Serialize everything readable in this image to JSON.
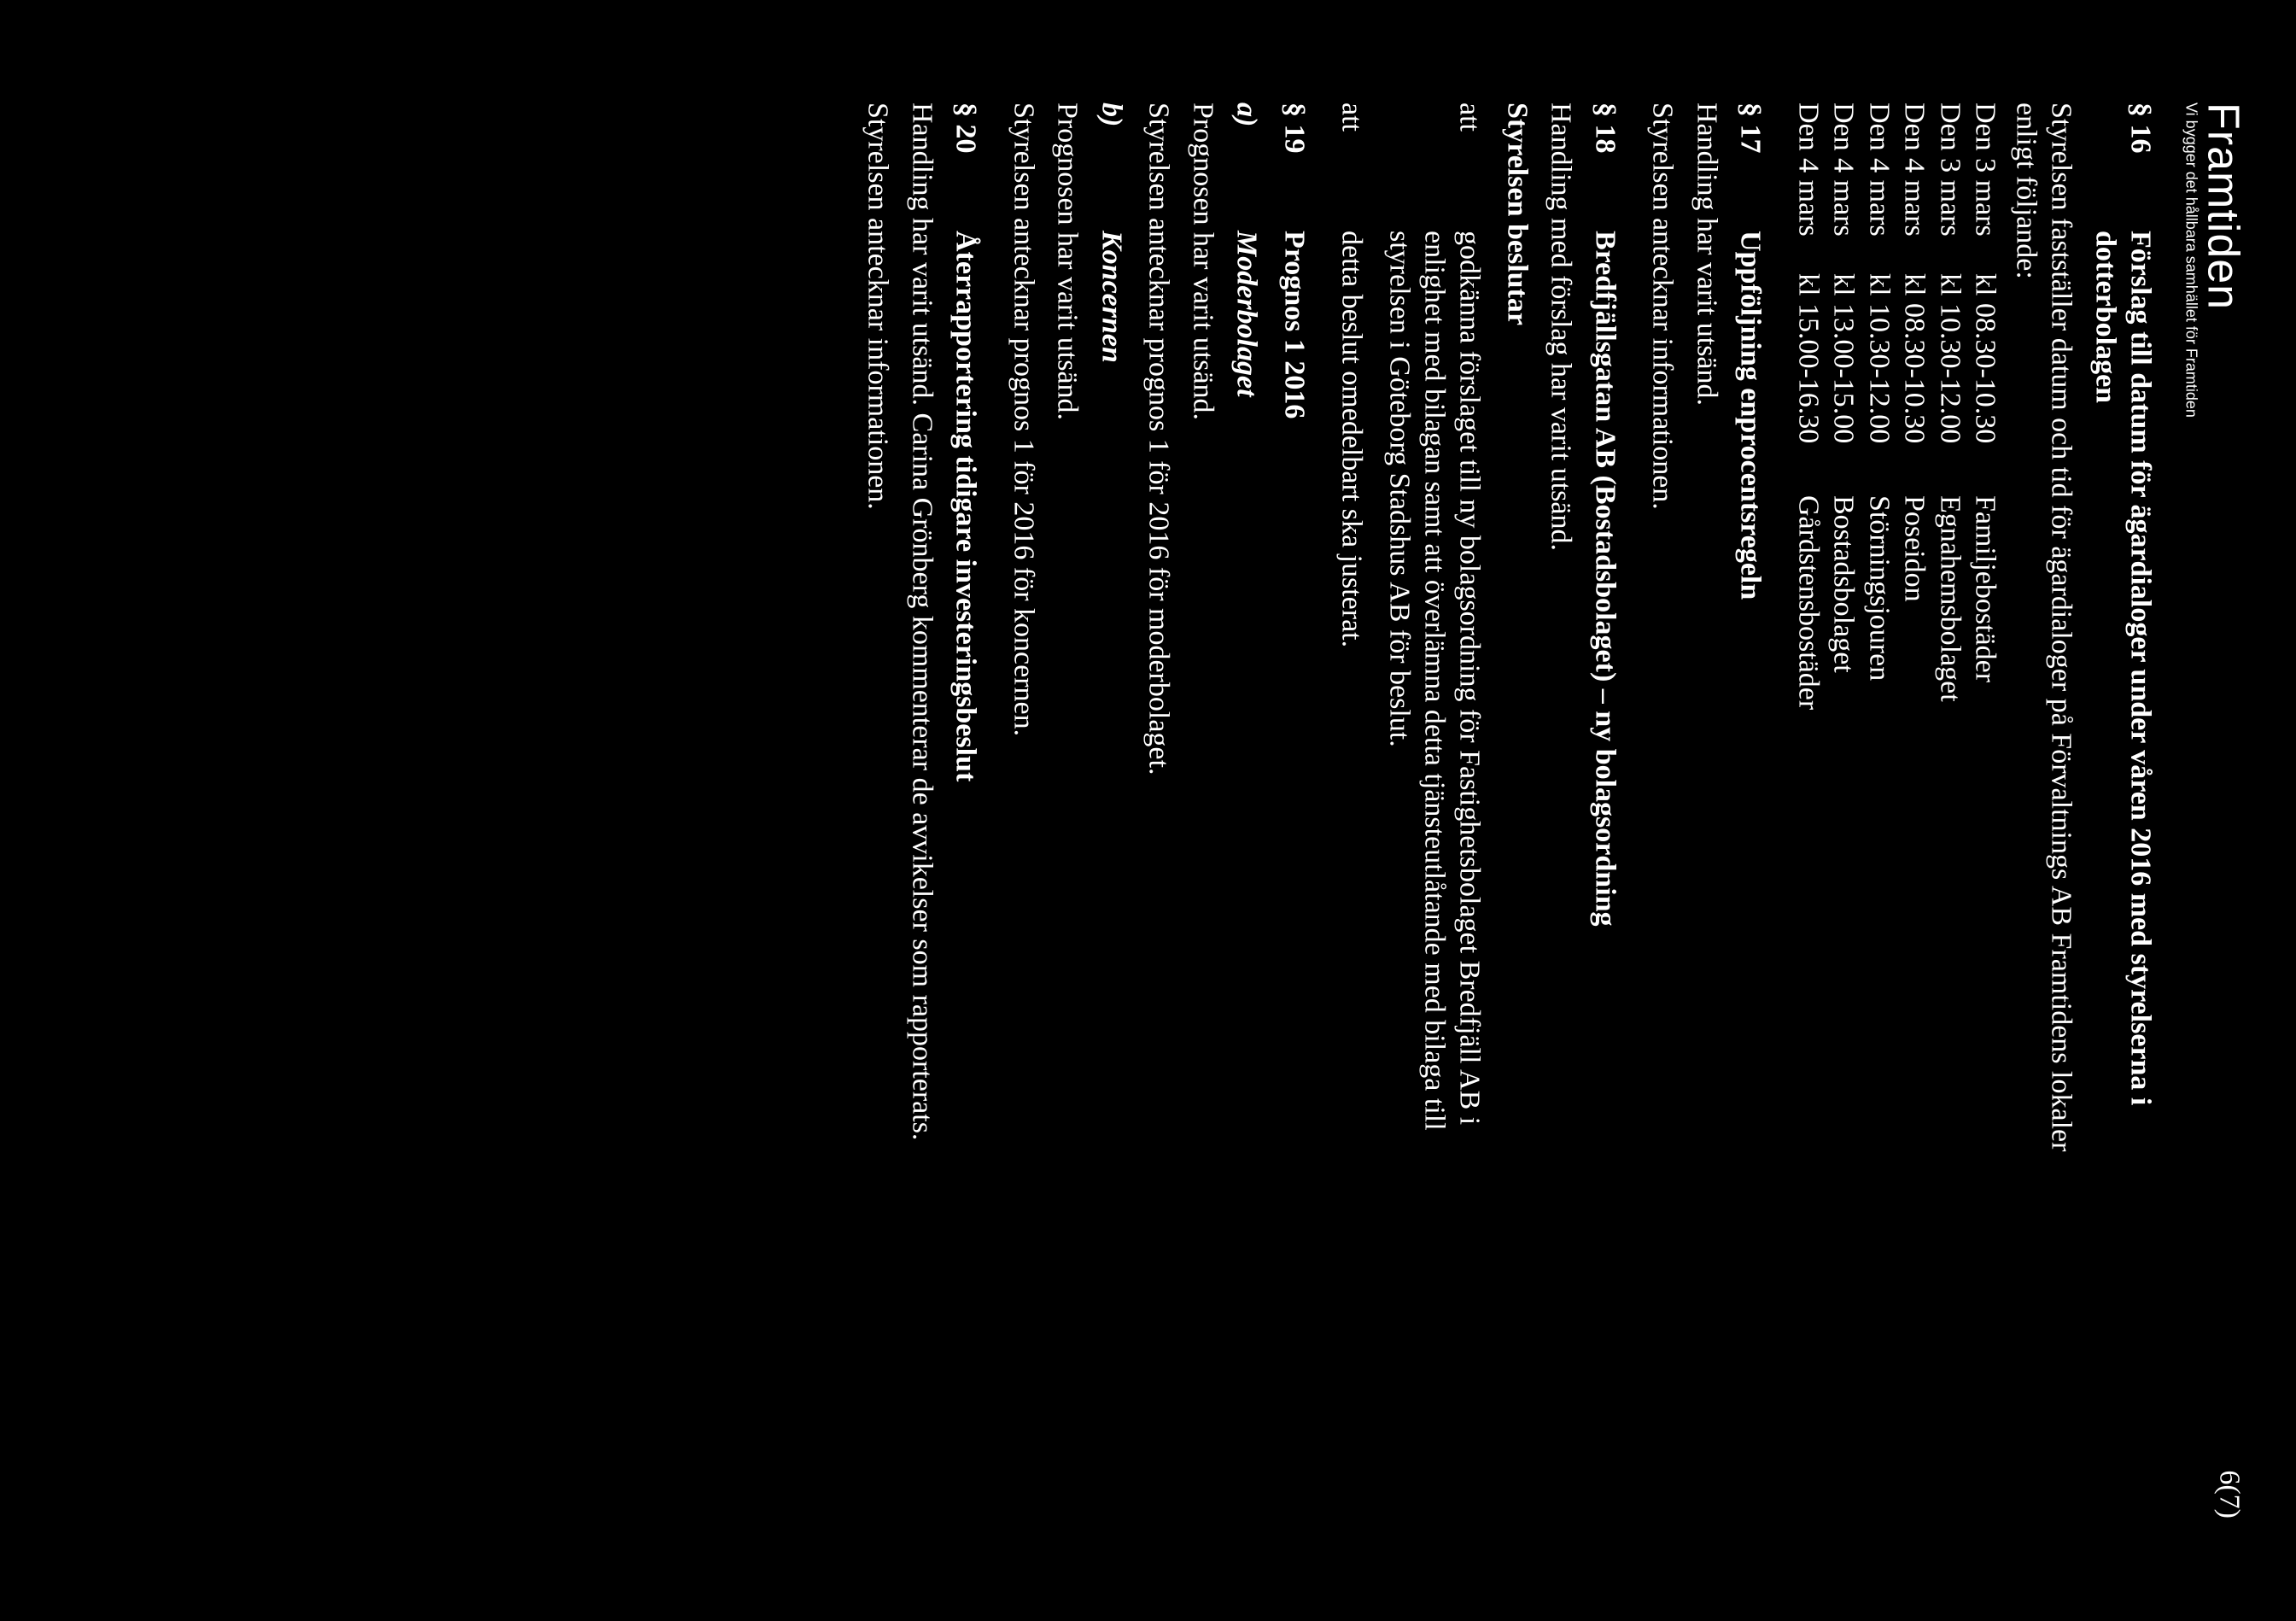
{
  "header": {
    "logo_main": "Framtiden",
    "logo_sub": "Vi bygger det hållbara samhället för Framtiden",
    "page_number": "6(7)"
  },
  "s16": {
    "num": "§ 16",
    "title1": "Förslag till datum för ägardialoger under våren 2016 med styrelserna i",
    "title2": "dotterbolagen",
    "intro1": "Styrelsen fastställer datum och tid för ägardialoger på Förvaltnings AB Framtidens lokaler",
    "intro2": "enligt följande:",
    "rows": [
      {
        "date": "Den 3 mars",
        "time": "kl 08.30-10.30",
        "name": "Familjebostäder"
      },
      {
        "date": "Den 3 mars",
        "time": "kl 10.30-12.00",
        "name": "Egnahemsbolaget"
      },
      {
        "date": "Den 4 mars",
        "time": "kl 08.30-10.30",
        "name": "Poseidon"
      },
      {
        "date": "Den 4 mars",
        "time": "kl 10.30-12.00",
        "name": "Störningsjouren"
      },
      {
        "date": "Den 4 mars",
        "time": "kl 13.00-15.00",
        "name": "Bostadsbolaget"
      },
      {
        "date": "Den 4 mars",
        "time": "kl 15.00-16.30",
        "name": "Gårdstensbostäder"
      }
    ]
  },
  "s17": {
    "num": "§ 17",
    "title": "Uppföljning enprocentsregeln",
    "p1": "Handling har varit utsänd.",
    "p2": "Styrelsen antecknar informationen."
  },
  "s18": {
    "num": "§ 18",
    "title": "Bredfjällsgatan AB (Bostadsbolaget) – ny bolagsordning",
    "p1": "Handling med förslag har varit utsänd.",
    "decision_heading": "Styrelsen beslutar",
    "att1_label": "att",
    "att1_text1": "godkänna förslaget till ny bolagsordning för Fastighetsbolaget Bredfjäll AB i",
    "att1_text2": "enlighet med bilagan samt att överlämna detta tjänsteutlåtande med bilaga till",
    "att1_text3": "styrelsen i Göteborg Stadshus AB för beslut.",
    "att2_label": "att",
    "att2_text": "detta beslut omedelbart ska justerat."
  },
  "s19": {
    "num": "§ 19",
    "title": "Prognos 1 2016",
    "a_letter": "a)",
    "a_title": "Moderbolaget",
    "a_p1": "Prognosen har varit utsänd.",
    "a_p2": "Styrelsen antecknar prognos 1 för 2016 för moderbolaget.",
    "b_letter": "b)",
    "b_title": "Koncernen",
    "b_p1": "Prognosen har varit utsänd.",
    "b_p2": "Styrelsen antecknar prognos 1 för 2016 för koncernen."
  },
  "s20": {
    "num": "§ 20",
    "title": "Återrapportering tidigare investeringsbeslut",
    "p1": "Handling har varit utsänd. Carina Grönberg kommenterar de avvikelser som rapporterats.",
    "p2": "Styrelsen antecknar informationen."
  }
}
